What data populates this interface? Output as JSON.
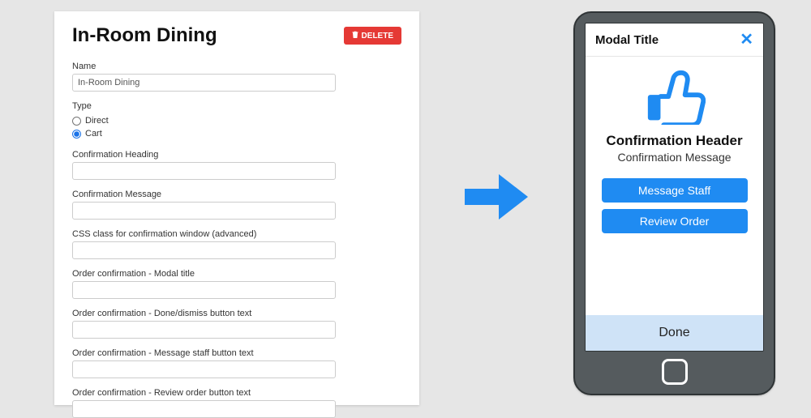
{
  "form": {
    "title": "In-Room Dining",
    "delete_label": "DELETE",
    "fields": {
      "name_label": "Name",
      "name_value": "In-Room Dining",
      "type_label": "Type",
      "type_options": {
        "direct": "Direct",
        "cart": "Cart"
      },
      "type_selected": "cart",
      "confirmation_heading_label": "Confirmation Heading",
      "confirmation_message_label": "Confirmation Message",
      "css_class_label": "CSS class for confirmation window (advanced)",
      "modal_title_label": "Order confirmation - Modal title",
      "done_button_label": "Order confirmation - Done/dismiss button text",
      "message_staff_label": "Order confirmation - Message staff button text",
      "review_order_label": "Order confirmation - Review order button text"
    }
  },
  "phone": {
    "modal_title": "Modal Title",
    "confirmation_header": "Confirmation Header",
    "confirmation_message": "Confirmation Message",
    "btn_message_staff": "Message Staff",
    "btn_review_order": "Review Order",
    "btn_done": "Done"
  },
  "colors": {
    "accent_blue": "#1f8bf2",
    "danger_red": "#e53935",
    "phone_body": "#555b5e"
  }
}
